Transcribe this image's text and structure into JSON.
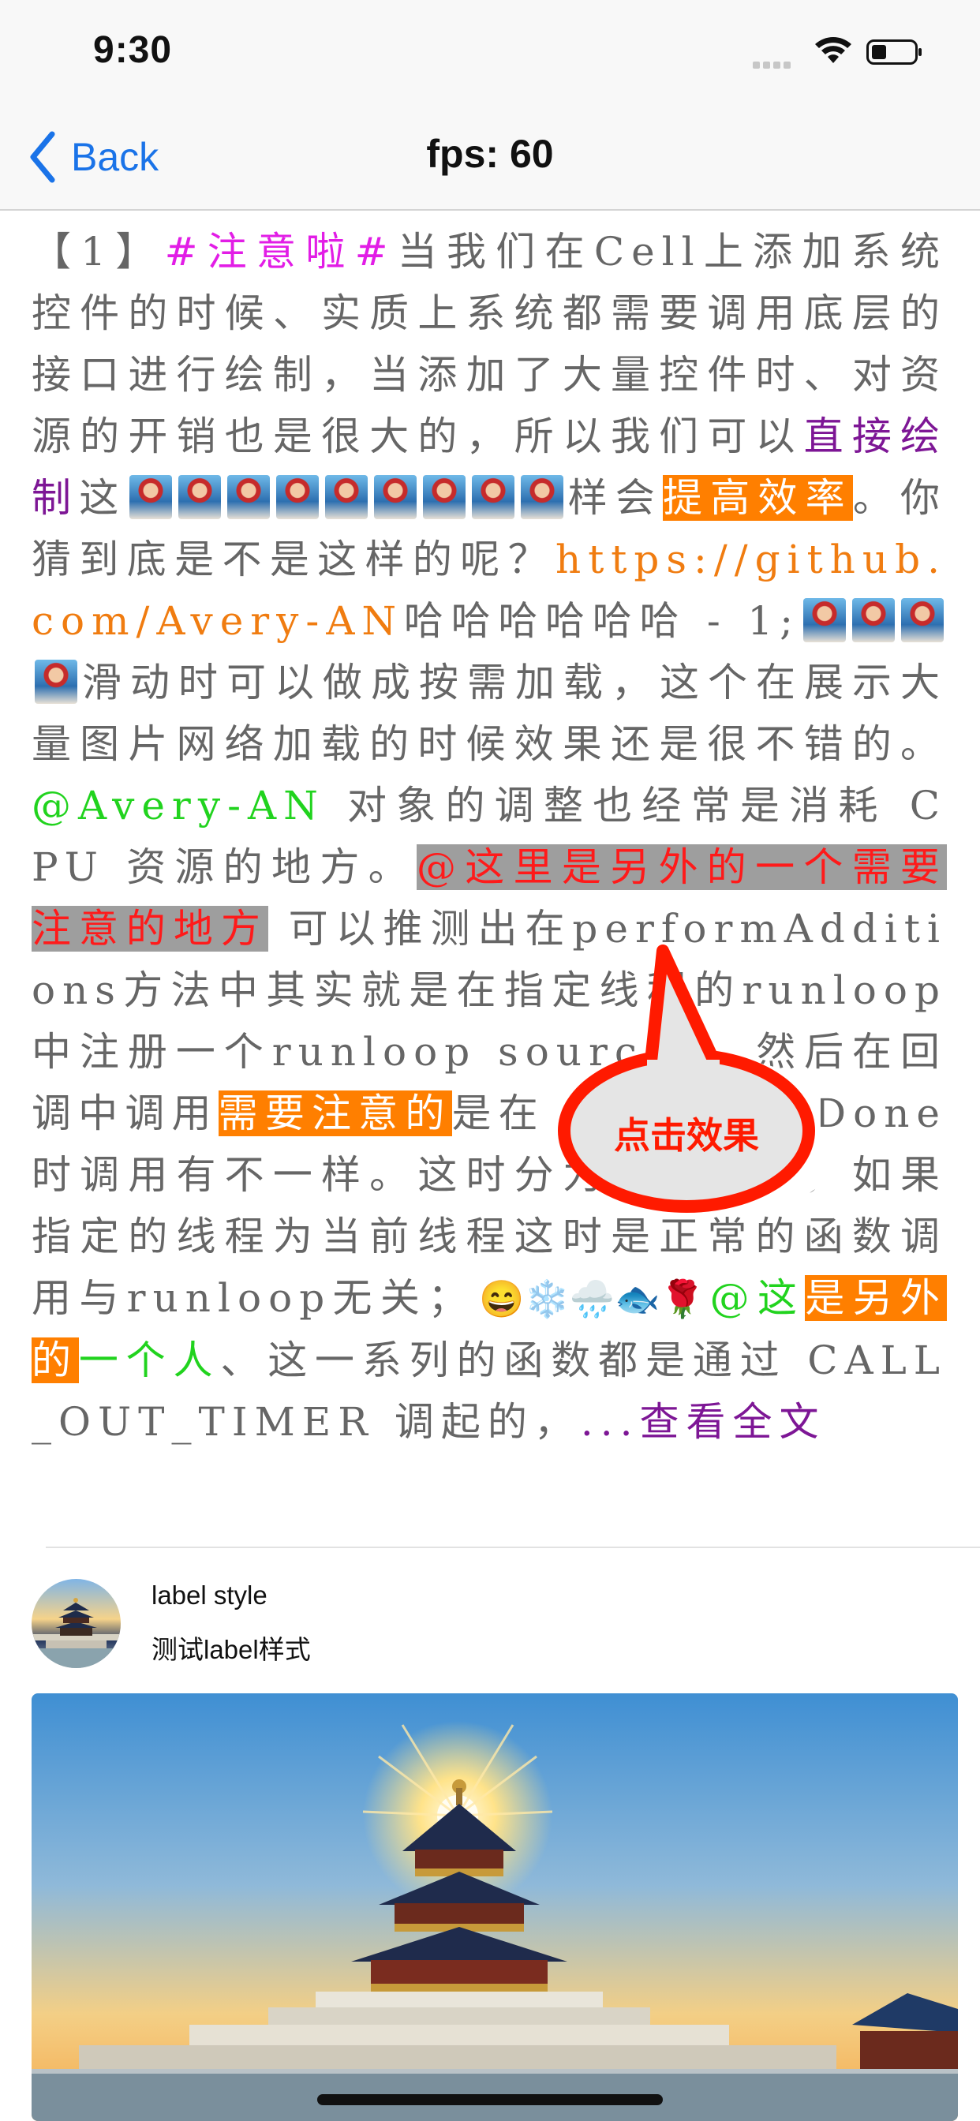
{
  "status_bar": {
    "time": "9:30"
  },
  "nav": {
    "back_label": "Back",
    "title": "fps: 60"
  },
  "article": {
    "t1": "【1】",
    "topic": "#注意啦#",
    "t2": "当我们在Cell上添加系统控件的时候、实质上系统都需要调用底层的接口进行绘制，当添加了大量控件时、对资源的开销也是很大的，所以我们可以",
    "direct_draw": "直接绘制",
    "t3": "这",
    "t4": "样会",
    "improve": "提高效率",
    "t5": "。你猜到底是不是这样的呢？",
    "link": "https://github.com/Avery-AN",
    "t6": "哈哈哈哈哈哈 - 1;",
    "t7": "滑动时可以做成按需加载，这个在展示大量图片网络加载的时候效果还是很不错的。",
    "mention1": "@Avery-AN",
    "t8": " 对象的调整也经常是消耗 CPU 资源的地方。",
    "highlight": "@这里是另外的一个需要注意的地方",
    "t9": " 可以推测出在performAdditions方法中其实就是在指定线程的runloop中注册一个runloop source0、然后在回调中调用",
    "attention": "需要注意的",
    "t10": "是在 waitUntilDone 时调用有不一样。这时分为两种情况，如果指定的线程为当前线程这时是正常的函数调用与runloop无关；",
    "emojis": "😄❄️🌧️🐟🌹",
    "mention2": "@这",
    "other": "是另外的",
    "person": "一个人",
    "t11": "、这一系列的函数都是通过 CALL_OUT_TIMER 调起的，",
    "more": "...查看全文"
  },
  "callout": {
    "label": "点击效果"
  },
  "profile": {
    "name": "label style",
    "subtitle": "测试label样式"
  },
  "colors": {
    "tint": "#1a73e8",
    "orange": "#ff7f00",
    "callout": "#ff1a00"
  }
}
